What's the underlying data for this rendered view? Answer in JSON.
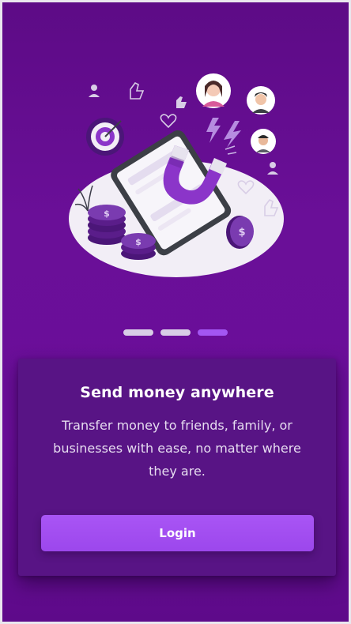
{
  "onboarding": {
    "title": "Send money anywhere",
    "description": "Transfer money to friends, family, or businesses with ease, no matter where they are.",
    "login_label": "Login",
    "pager": {
      "total": 3,
      "active_index": 2
    }
  },
  "illustration": {
    "subject": "phone-with-magnet-attracting-people-and-coins",
    "icons": [
      "magnet-icon",
      "smartphone-icon",
      "coin-icon",
      "target-icon",
      "heart-icon",
      "thumbs-up-icon",
      "user-icon",
      "lightning-icon"
    ]
  },
  "colors": {
    "background": "#6a0f98",
    "card": "#581485",
    "accent": "#a356f2",
    "pager_inactive": "#d8cde6",
    "text": "#ffffff"
  }
}
